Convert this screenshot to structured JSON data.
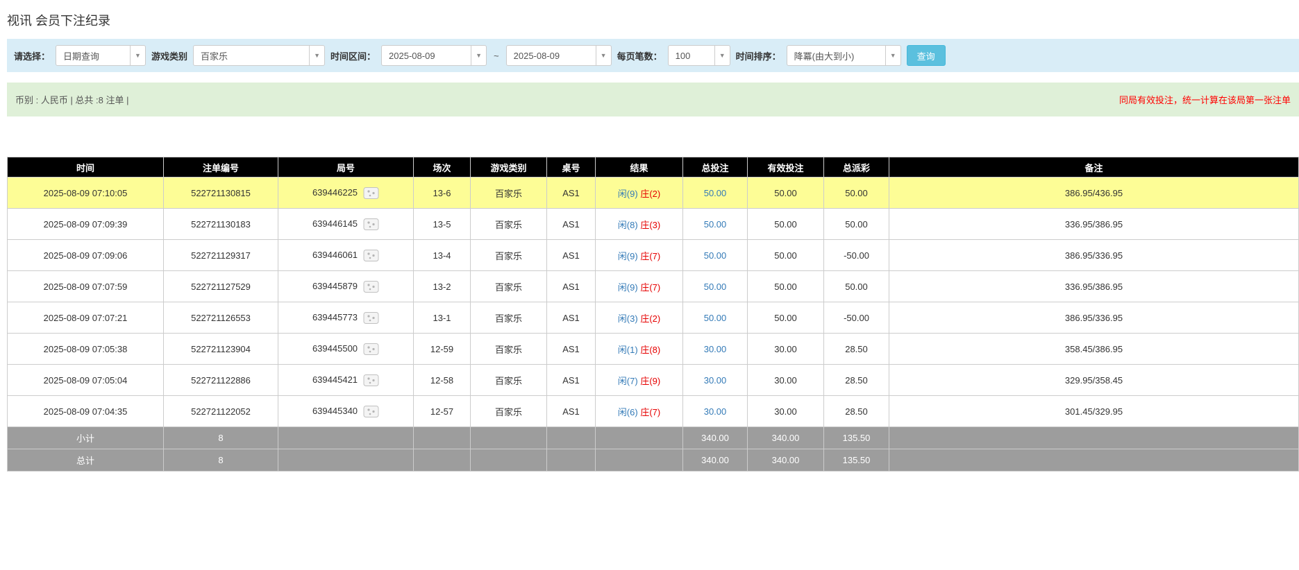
{
  "page": {
    "title": "视讯 会员下注纪录"
  },
  "filters": {
    "select_label": "请选择：",
    "select_value": "日期查询",
    "game_type_label": "游戏类别",
    "game_type_value": "百家乐",
    "time_range_label": "时间区间：",
    "date_from": "2025-08-09",
    "tilde": "~",
    "date_to": "2025-08-09",
    "page_size_label": "每页笔数：",
    "page_size_value": "100",
    "sort_label": "时间排序：",
    "sort_value": "降冪(由大到小)",
    "search_button": "查询",
    "caret_glyph": "▼"
  },
  "info_bar": {
    "left": "币别 : 人民币 | 总共 :8 注单 |",
    "right": "同局有效投注，统一计算在该局第一张注单"
  },
  "table": {
    "headers": [
      "时间",
      "注单编号",
      "局号",
      "场次",
      "游戏类别",
      "桌号",
      "结果",
      "总投注",
      "有效投注",
      "总派彩",
      "备注"
    ],
    "rows": [
      {
        "time": "2025-08-09 07:10:05",
        "bet_id": "522721130815",
        "round_id": "639446225",
        "session": "13-6",
        "game_type": "百家乐",
        "table_no": "AS1",
        "result_player": "闲(9)",
        "result_banker": "庄(2)",
        "total_bet": "50.00",
        "valid_bet": "50.00",
        "payout": "50.00",
        "note": "386.95/436.95",
        "highlighted": true
      },
      {
        "time": "2025-08-09 07:09:39",
        "bet_id": "522721130183",
        "round_id": "639446145",
        "session": "13-5",
        "game_type": "百家乐",
        "table_no": "AS1",
        "result_player": "闲(8)",
        "result_banker": "庄(3)",
        "total_bet": "50.00",
        "valid_bet": "50.00",
        "payout": "50.00",
        "note": "336.95/386.95",
        "highlighted": false
      },
      {
        "time": "2025-08-09 07:09:06",
        "bet_id": "522721129317",
        "round_id": "639446061",
        "session": "13-4",
        "game_type": "百家乐",
        "table_no": "AS1",
        "result_player": "闲(9)",
        "result_banker": "庄(7)",
        "total_bet": "50.00",
        "valid_bet": "50.00",
        "payout": "-50.00",
        "note": "386.95/336.95",
        "highlighted": false
      },
      {
        "time": "2025-08-09 07:07:59",
        "bet_id": "522721127529",
        "round_id": "639445879",
        "session": "13-2",
        "game_type": "百家乐",
        "table_no": "AS1",
        "result_player": "闲(9)",
        "result_banker": "庄(7)",
        "total_bet": "50.00",
        "valid_bet": "50.00",
        "payout": "50.00",
        "note": "336.95/386.95",
        "highlighted": false
      },
      {
        "time": "2025-08-09 07:07:21",
        "bet_id": "522721126553",
        "round_id": "639445773",
        "session": "13-1",
        "game_type": "百家乐",
        "table_no": "AS1",
        "result_player": "闲(3)",
        "result_banker": "庄(2)",
        "total_bet": "50.00",
        "valid_bet": "50.00",
        "payout": "-50.00",
        "note": "386.95/336.95",
        "highlighted": false
      },
      {
        "time": "2025-08-09 07:05:38",
        "bet_id": "522721123904",
        "round_id": "639445500",
        "session": "12-59",
        "game_type": "百家乐",
        "table_no": "AS1",
        "result_player": "闲(1)",
        "result_banker": "庄(8)",
        "total_bet": "30.00",
        "valid_bet": "30.00",
        "payout": "28.50",
        "note": "358.45/386.95",
        "highlighted": false
      },
      {
        "time": "2025-08-09 07:05:04",
        "bet_id": "522721122886",
        "round_id": "639445421",
        "session": "12-58",
        "game_type": "百家乐",
        "table_no": "AS1",
        "result_player": "闲(7)",
        "result_banker": "庄(9)",
        "total_bet": "30.00",
        "valid_bet": "30.00",
        "payout": "28.50",
        "note": "329.95/358.45",
        "highlighted": false
      },
      {
        "time": "2025-08-09 07:04:35",
        "bet_id": "522721122052",
        "round_id": "639445340",
        "session": "12-57",
        "game_type": "百家乐",
        "table_no": "AS1",
        "result_player": "闲(6)",
        "result_banker": "庄(7)",
        "total_bet": "30.00",
        "valid_bet": "30.00",
        "payout": "28.50",
        "note": "301.45/329.95",
        "highlighted": false
      }
    ],
    "footer_rows": [
      {
        "label": "小计",
        "count": "8",
        "total_bet": "340.00",
        "valid_bet": "340.00",
        "payout": "135.50"
      },
      {
        "label": "总计",
        "count": "8",
        "total_bet": "340.00",
        "valid_bet": "340.00",
        "payout": "135.50"
      }
    ]
  }
}
